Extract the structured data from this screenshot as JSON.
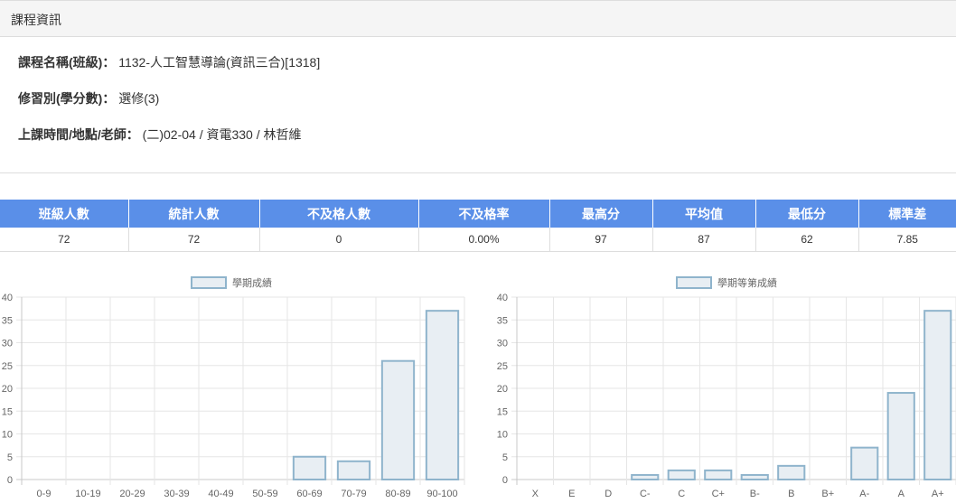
{
  "panel": {
    "title": "課程資訊"
  },
  "course": {
    "name_label": "課程名稱(班級)：",
    "name_value": "1132-人工智慧導論(資訊三合)[1318]",
    "type_label": "修習別(學分數)：",
    "type_value": "選修(3)",
    "schedule_label": "上課時間/地點/老師：",
    "schedule_value": "(二)02-04 / 資電330 / 林哲維"
  },
  "stats": {
    "headers": [
      "班級人數",
      "統計人數",
      "不及格人數",
      "不及格率",
      "最高分",
      "平均值",
      "最低分",
      "標準差"
    ],
    "values": [
      "72",
      "72",
      "0",
      "0.00%",
      "97",
      "87",
      "62",
      "7.85"
    ]
  },
  "colors": {
    "header_bg": "#5a8fe8",
    "bar_fill": "#e8eef3",
    "bar_stroke": "#8fb4cc"
  },
  "chart_data": [
    {
      "type": "bar",
      "categories": [
        "0-9",
        "10-19",
        "20-29",
        "30-39",
        "40-49",
        "50-59",
        "60-69",
        "70-79",
        "80-89",
        "90-100"
      ],
      "series": [
        {
          "name": "學期成績",
          "values": [
            0,
            0,
            0,
            0,
            0,
            0,
            5,
            4,
            26,
            37
          ]
        }
      ],
      "ylim": [
        0,
        40
      ],
      "yticks": [
        "0",
        "5",
        "10",
        "15",
        "20",
        "25",
        "30",
        "35",
        "40"
      ],
      "grid": true,
      "legend": "top"
    },
    {
      "type": "bar",
      "categories": [
        "X",
        "E",
        "D",
        "C-",
        "C",
        "C+",
        "B-",
        "B",
        "B+",
        "A-",
        "A",
        "A+"
      ],
      "series": [
        {
          "name": "學期等第成績",
          "values": [
            0,
            0,
            0,
            1,
            2,
            2,
            1,
            3,
            0,
            7,
            19,
            37
          ]
        }
      ],
      "ylim": [
        0,
        40
      ],
      "yticks": [
        "0",
        "5",
        "10",
        "15",
        "20",
        "25",
        "30",
        "35",
        "40"
      ],
      "grid": true,
      "legend": "top"
    }
  ]
}
